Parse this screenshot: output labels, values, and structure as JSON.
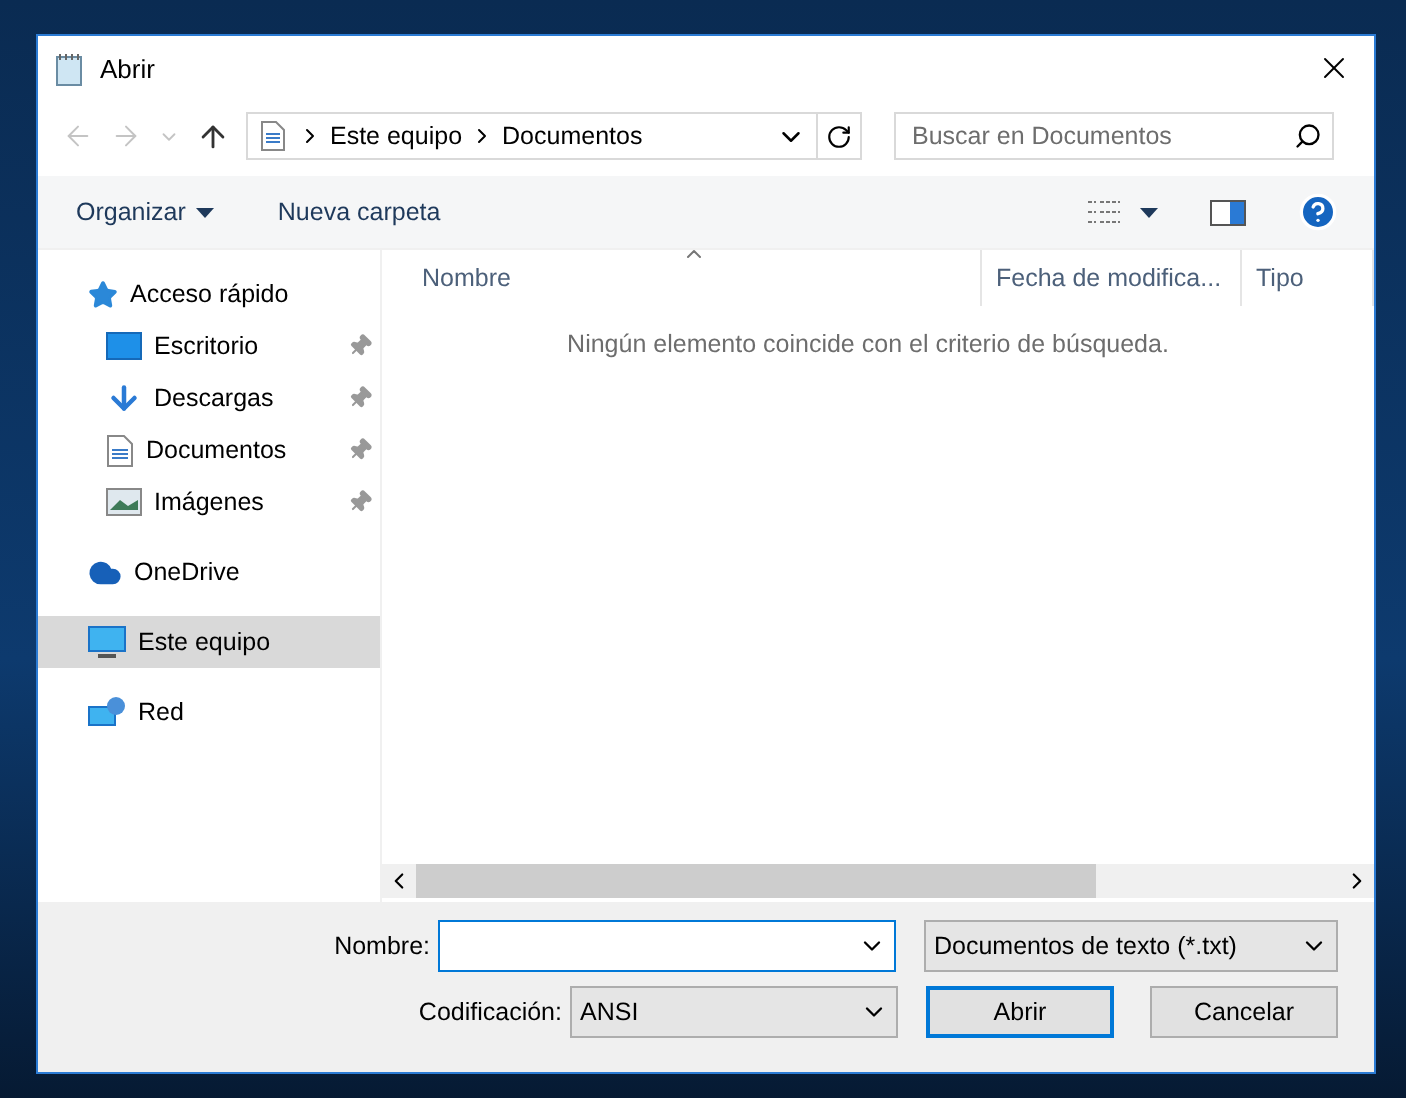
{
  "window": {
    "title": "Abrir"
  },
  "address_bar": {
    "path": [
      "Este equipo",
      "Documentos"
    ]
  },
  "search": {
    "placeholder": "Buscar en Documentos"
  },
  "toolbar": {
    "organize": "Organizar",
    "new_folder": "Nueva carpeta"
  },
  "nav_pane": {
    "groups": [
      {
        "label": "Acceso rápido",
        "kind": "star",
        "selected": false,
        "children": [
          {
            "label": "Escritorio",
            "kind": "desktop",
            "pinned": true
          },
          {
            "label": "Descargas",
            "kind": "download",
            "pinned": true
          },
          {
            "label": "Documentos",
            "kind": "document",
            "pinned": true
          },
          {
            "label": "Imágenes",
            "kind": "pictures",
            "pinned": true
          }
        ]
      },
      {
        "label": "OneDrive",
        "kind": "cloud",
        "selected": false
      },
      {
        "label": "Este equipo",
        "kind": "computer",
        "selected": true
      },
      {
        "label": "Red",
        "kind": "network",
        "selected": false
      }
    ]
  },
  "file_list": {
    "columns": [
      {
        "label": "Nombre",
        "sorted": true
      },
      {
        "label": "Fecha de modifica...",
        "sorted": false
      },
      {
        "label": "Tipo",
        "sorted": false
      }
    ],
    "empty_message": "Ningún elemento coincide con el criterio de búsqueda."
  },
  "footer": {
    "name_label": "Nombre:",
    "filter": "Documentos de texto (*.txt)",
    "encoding_label": "Codificación:",
    "encoding": "ANSI",
    "buttons": [
      {
        "label": "Abrir",
        "default": true
      },
      {
        "label": "Cancelar",
        "default": false
      }
    ]
  }
}
